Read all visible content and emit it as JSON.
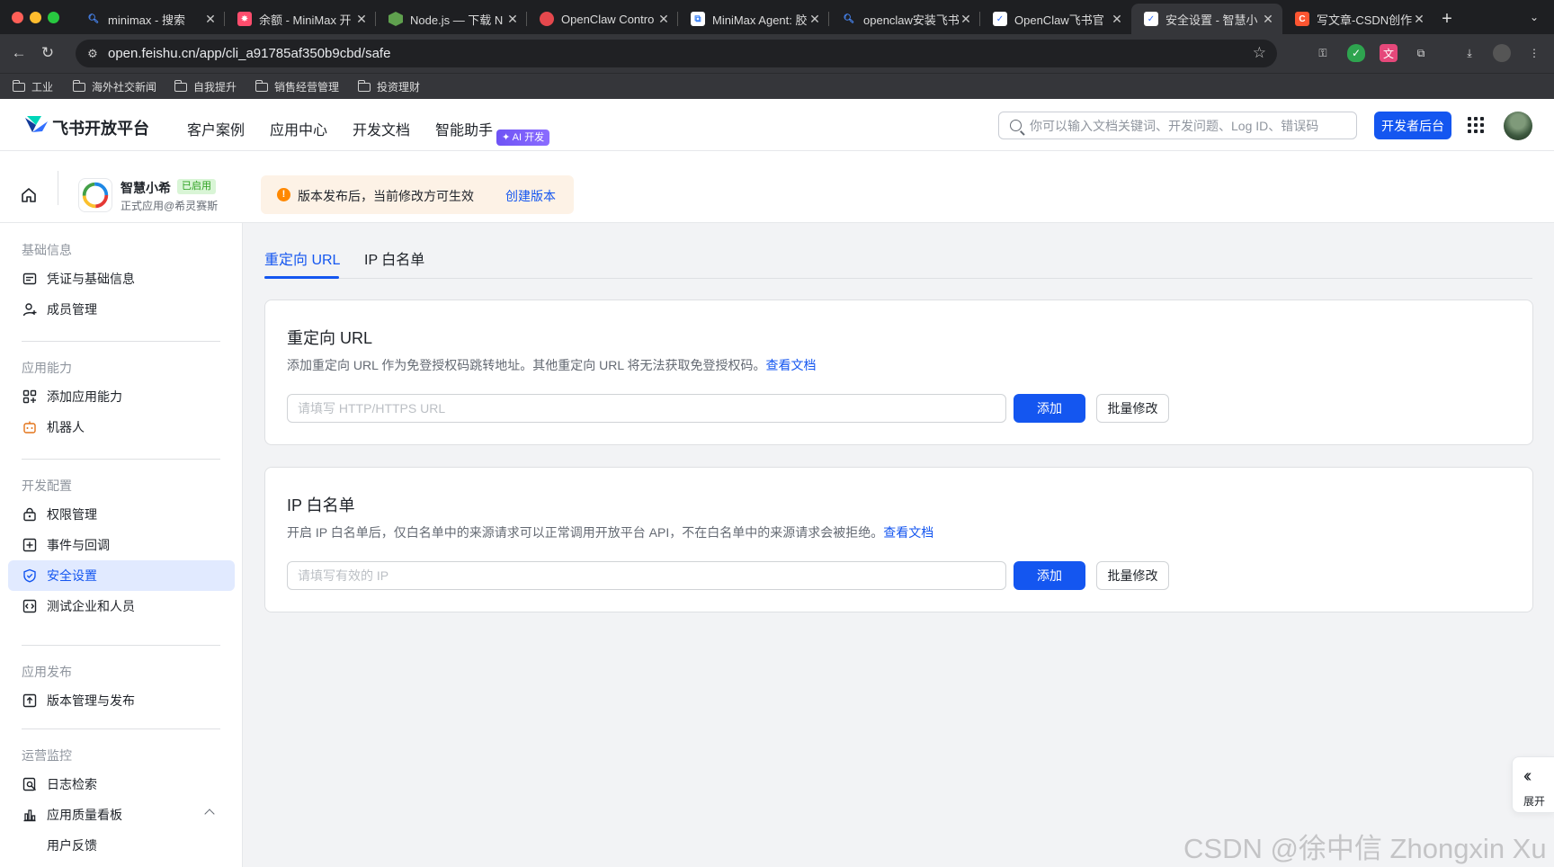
{
  "browser": {
    "tabs": [
      {
        "title": "minimax - 搜索",
        "favicon": "search-icon",
        "color": "#4a8cff"
      },
      {
        "title": "余额 - MiniMax 开",
        "favicon": "minimax-icon",
        "color": "#ff4d6d"
      },
      {
        "title": "Node.js — 下载 N",
        "favicon": "nodejs-icon",
        "color": "#5fa04e"
      },
      {
        "title": "OpenClaw Contro",
        "favicon": "openclaw-icon",
        "color": "#e5484d"
      },
      {
        "title": "MiniMax Agent: 胶",
        "favicon": "minimax-agent-icon",
        "color": "#3b82f6"
      },
      {
        "title": "openclaw安装飞书",
        "favicon": "search-icon",
        "color": "#4a8cff"
      },
      {
        "title": "OpenClaw飞书官",
        "favicon": "feishu-icon",
        "color": "#3370ff"
      },
      {
        "title": "安全设置 - 智慧小",
        "favicon": "feishu-icon",
        "color": "#3370ff",
        "active": true
      },
      {
        "title": "写文章-CSDN创作",
        "favicon": "csdn-icon",
        "color": "#fc5531"
      }
    ],
    "url": "open.feishu.cn/app/cli_a91785af350b9cbd/safe",
    "bookmarks": [
      "工业",
      "海外社交新闻",
      "自我提升",
      "销售经营管理",
      "投资理财"
    ]
  },
  "header": {
    "logo": "飞书开放平台",
    "nav": [
      "客户案例",
      "应用中心",
      "开发文档",
      "智能助手"
    ],
    "ai_badge": "✦ AI 开发",
    "search_placeholder": "你可以输入文档关键词、开发问题、Log ID、错误码",
    "dev_button": "开发者后台"
  },
  "app": {
    "name": "智慧小希",
    "status": "已启用",
    "subtitle": "正式应用@希灵赛斯",
    "notice": "版本发布后，当前修改方可生效",
    "notice_link": "创建版本"
  },
  "sidebar": {
    "sections": [
      {
        "title": "基础信息",
        "items": [
          "凭证与基础信息",
          "成员管理"
        ]
      },
      {
        "title": "应用能力",
        "items": [
          "添加应用能力",
          "机器人"
        ]
      },
      {
        "title": "开发配置",
        "items": [
          "权限管理",
          "事件与回调",
          "安全设置",
          "测试企业和人员"
        ]
      },
      {
        "title": "应用发布",
        "items": [
          "版本管理与发布"
        ]
      },
      {
        "title": "运营监控",
        "items": [
          "日志检索",
          "应用质量看板",
          "用户反馈"
        ]
      }
    ],
    "active": "安全设置"
  },
  "main": {
    "tabs": [
      "重定向 URL",
      "IP 白名单"
    ],
    "redirect": {
      "title": "重定向 URL",
      "desc": "添加重定向 URL 作为免登授权码跳转地址。其他重定向 URL 将无法获取免登授权码。",
      "link": "查看文档",
      "placeholder": "请填写 HTTP/HTTPS URL",
      "add": "添加",
      "batch": "批量修改"
    },
    "ip": {
      "title": "IP 白名单",
      "desc": "开启 IP 白名单后，仅白名单中的来源请求可以正常调用开放平台 API，不在白名单中的来源请求会被拒绝。",
      "link": "查看文档",
      "placeholder": "请填写有效的 IP",
      "add": "添加",
      "batch": "批量修改"
    },
    "expand_label": "展开"
  },
  "watermark": "CSDN @徐中信 Zhongxin Xu"
}
